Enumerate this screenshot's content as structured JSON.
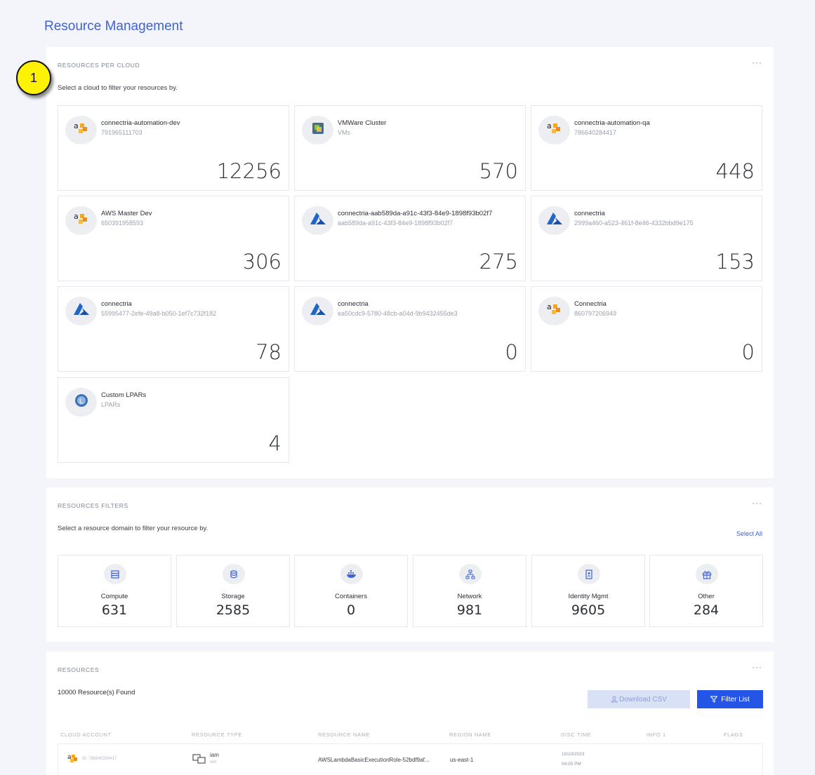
{
  "page_title": "Resource Management",
  "marker_label": "1",
  "cloud_panel": {
    "title": "RESOURCES PER CLOUD",
    "menu": "···",
    "subtitle": "Select a cloud to filter your resources by.",
    "cards": [
      {
        "name": "connectria-automation-dev",
        "id": "791965111703",
        "count": "12256",
        "icon": "aws-icon"
      },
      {
        "name": "VMWare Cluster",
        "id": "VMs",
        "count": "570",
        "icon": "vmware-icon"
      },
      {
        "name": "connectria-automation-qa",
        "id": "786640284417",
        "count": "448",
        "icon": "aws-icon"
      },
      {
        "name": "AWS Master Dev",
        "id": "650391958593",
        "count": "306",
        "icon": "aws-icon"
      },
      {
        "name": "connectria-aab589da-a91c-43f3-84e9-1898f93b02f7",
        "id": "aab589da-a91c-43f3-84e9-1898f93b02f7",
        "count": "275",
        "icon": "azure-icon"
      },
      {
        "name": "connectria",
        "id": "2999a460-a523-461f-8e46-4332bbd9e175",
        "count": "153",
        "icon": "azure-icon"
      },
      {
        "name": "connectria",
        "id": "55995477-2efe-49a8-b050-1ef7c732f182",
        "count": "78",
        "icon": "azure-icon"
      },
      {
        "name": "connectria",
        "id": "ea50cdc9-5780-48cb-a04d-9b9432455de3",
        "count": "0",
        "icon": "azure-icon"
      },
      {
        "name": "Connectria",
        "id": "860797206949",
        "count": "0",
        "icon": "aws-icon"
      },
      {
        "name": "Custom LPARs",
        "id": "LPARs",
        "count": "4",
        "icon": "lpar-icon"
      }
    ]
  },
  "filter_panel": {
    "title": "RESOURCES FILTERS",
    "menu": "···",
    "subtitle": "Select a resource domain to filter your resource by.",
    "select_all": "Select All",
    "domains": [
      {
        "label": "Compute",
        "count": "631",
        "icon": "compute-icon"
      },
      {
        "label": "Storage",
        "count": "2585",
        "icon": "storage-icon"
      },
      {
        "label": "Containers",
        "count": "0",
        "icon": "containers-icon"
      },
      {
        "label": "Network",
        "count": "981",
        "icon": "network-icon"
      },
      {
        "label": "Identity Mgmt",
        "count": "9605",
        "icon": "identity-icon"
      },
      {
        "label": "Other",
        "count": "284",
        "icon": "other-icon"
      }
    ]
  },
  "resources_panel": {
    "title": "RESOURCES",
    "menu": "···",
    "found": "10000 Resource(s) Found",
    "download_label": "Download CSV",
    "filter_label": "Filter List",
    "columns": [
      "CLOUD ACCOUNT",
      "RESOURCE TYPE",
      "RESOURCE NAME",
      "REGION NAME",
      "DISC TIME",
      "INFO 1",
      "FLAGS"
    ],
    "rows": [
      {
        "account_id": "ID: 786640284417",
        "type": "iam",
        "type_sub": "iam",
        "name": "AWSLambdaBasicExecutionRole-52bdf9af...",
        "region": "us-east-1",
        "date": "10/10/2023",
        "time": "04:05 PM"
      }
    ]
  },
  "colors": {
    "accent": "#2555e6",
    "title": "#3d63d6",
    "aws_orange": "#f5a623",
    "azure_blue": "#1f66c6"
  }
}
